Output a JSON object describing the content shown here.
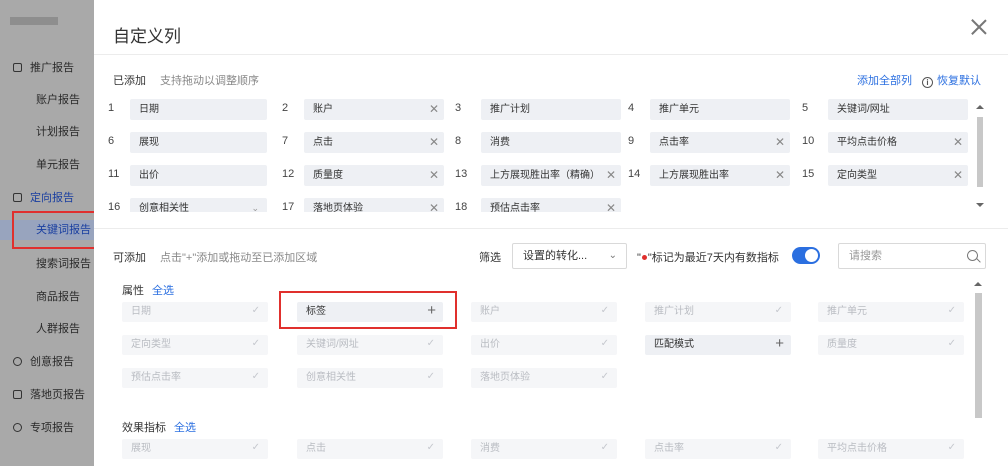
{
  "sidebar": {
    "items": [
      {
        "label": "推广报告",
        "type": "group",
        "icon": "checkbox-icon"
      },
      {
        "label": "账户报告",
        "type": "sub"
      },
      {
        "label": "计划报告",
        "type": "sub"
      },
      {
        "label": "单元报告",
        "type": "sub"
      },
      {
        "label": "定向报告",
        "type": "group",
        "icon": "target-icon",
        "active": true
      },
      {
        "label": "关键词报告",
        "type": "sub",
        "active": true,
        "selected": true
      },
      {
        "label": "搜索词报告",
        "type": "sub"
      },
      {
        "label": "商品报告",
        "type": "sub"
      },
      {
        "label": "人群报告",
        "type": "sub"
      },
      {
        "label": "创意报告",
        "type": "group",
        "icon": "creative-icon"
      },
      {
        "label": "落地页报告",
        "type": "group",
        "icon": "landing-icon"
      },
      {
        "label": "专项报告",
        "type": "group",
        "icon": "special-icon"
      }
    ]
  },
  "modal": {
    "title": "自定义列",
    "added": {
      "label": "已添加",
      "hint": "支持拖动以调整顺序",
      "add_all": "添加全部列",
      "restore": "恢复默认",
      "columns": [
        {
          "num": "1",
          "label": "日期",
          "fixed": true
        },
        {
          "num": "2",
          "label": "账户"
        },
        {
          "num": "3",
          "label": "推广计划",
          "fixed": true
        },
        {
          "num": "4",
          "label": "推广单元",
          "fixed": true
        },
        {
          "num": "5",
          "label": "关键词/网址",
          "fixed": true
        },
        {
          "num": "6",
          "label": "展现",
          "fixed": true
        },
        {
          "num": "7",
          "label": "点击"
        },
        {
          "num": "8",
          "label": "消费",
          "fixed": true
        },
        {
          "num": "9",
          "label": "点击率"
        },
        {
          "num": "10",
          "label": "平均点击价格"
        },
        {
          "num": "11",
          "label": "出价",
          "fixed": true
        },
        {
          "num": "12",
          "label": "质量度"
        },
        {
          "num": "13",
          "label": "上方展现胜出率（精确）"
        },
        {
          "num": "14",
          "label": "上方展现胜出率"
        },
        {
          "num": "15",
          "label": "定向类型"
        },
        {
          "num": "16",
          "label": "创意相关性"
        },
        {
          "num": "17",
          "label": "落地页体验"
        },
        {
          "num": "18",
          "label": "预估点击率"
        }
      ]
    },
    "available": {
      "label": "可添加",
      "hint": "点击\"+\"添加或拖动至已添加区域",
      "filter_label": "筛选",
      "filter_value": "设置的转化...",
      "metric_note_pre": "\"",
      "metric_note_post": "\"标记为最近7天内有数指标",
      "search_placeholder": "请搜索",
      "select_all": "全选",
      "groups": [
        {
          "label": "属性",
          "options": [
            {
              "label": "日期",
              "added": true
            },
            {
              "label": "标签",
              "added": false
            },
            {
              "label": "账户",
              "added": true
            },
            {
              "label": "推广计划",
              "added": true
            },
            {
              "label": "推广单元",
              "added": true
            },
            {
              "label": "定向类型",
              "added": true
            },
            {
              "label": "关键词/网址",
              "added": true
            },
            {
              "label": "出价",
              "added": true
            },
            {
              "label": "匹配模式",
              "added": false
            },
            {
              "label": "质量度",
              "added": true
            },
            {
              "label": "预估点击率",
              "added": true
            },
            {
              "label": "创意相关性",
              "added": true
            },
            {
              "label": "落地页体验",
              "added": true
            }
          ]
        },
        {
          "label": "效果指标",
          "options": [
            {
              "label": "展现",
              "added": true
            },
            {
              "label": "点击",
              "added": true
            },
            {
              "label": "消费",
              "added": true
            },
            {
              "label": "点击率",
              "added": true
            },
            {
              "label": "平均点击价格",
              "added": true
            }
          ]
        }
      ]
    }
  },
  "colors": {
    "accent": "#2b6fe0",
    "highlight": "#e0302d"
  }
}
